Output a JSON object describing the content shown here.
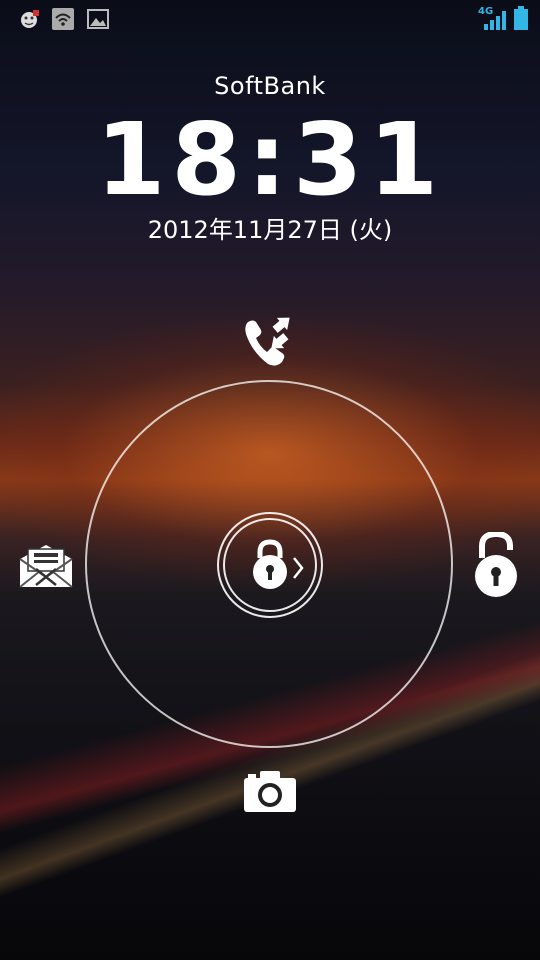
{
  "status_bar": {
    "left_icons": [
      "notification-app-icon",
      "wifi-alert-icon",
      "gallery-icon"
    ],
    "network_label": "4G",
    "right_icons": [
      "signal-icon",
      "battery-icon"
    ]
  },
  "lockscreen": {
    "carrier": "SoftBank",
    "time": "18:31",
    "date": "2012年11月27日 (火)"
  },
  "unlock_targets": {
    "top": "phone-icon",
    "left": "mail-icon",
    "right": "unlock-icon",
    "bottom": "camera-icon",
    "center": "lock-handle-icon"
  },
  "colors": {
    "accent": "#33b5e5",
    "ring": "#ffffff"
  }
}
